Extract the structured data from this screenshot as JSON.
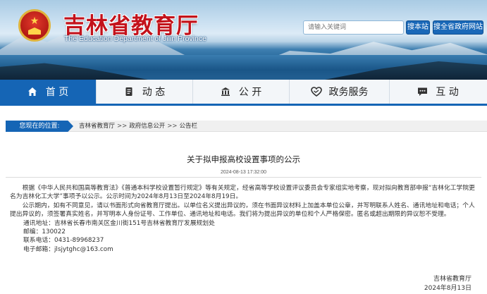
{
  "header": {
    "title": "吉林省教育厅",
    "subtitle": "The Education Department of Jilin Province",
    "search_placeholder": "请输入关键词",
    "search_site_label": "搜本站",
    "search_gov_label": "搜全省政府网站"
  },
  "nav": {
    "items": [
      {
        "label": "首 页",
        "icon": "home-icon"
      },
      {
        "label": "动 态",
        "icon": "document-icon"
      },
      {
        "label": "公 开",
        "icon": "government-building-icon"
      },
      {
        "label": "政务服务",
        "icon": "handshake-icon"
      },
      {
        "label": "互 动",
        "icon": "chat-icon"
      }
    ],
    "active_index": 0
  },
  "location": {
    "label": "您现在的位置:",
    "crumbs": [
      "吉林省教育厅",
      "政府信息公开",
      "公告栏"
    ],
    "separator": ">>"
  },
  "article": {
    "title": "关于拟申报高校设置事项的公示",
    "datetime": "2024-08-13 17:32:00",
    "para1": "根据《中华人民共和国高等教育法》《普通本科学校设置暂行规定》等有关规定，经省高等学校设置评议委员会专家组实地考察，现对拟向教育部申报“吉林化工学院更名为吉林化工大学”事项予以公示。公示时间为2024年8月13日至2024年8月19日。",
    "para2": "公示期内，如有不同意见，请以书面形式向省教育厅提出。以单位名义提出异议的，须在书面异议材料上加盖本单位公章，并写明联系人姓名、通讯地址和电话；个人提出异议的，须签署真实姓名，并写明本人身份证号、工作单位、通讯地址和电话。我们将为提出异议的单位和个人严格保密。匿名或超出期限的异议恕不受理。",
    "contact_address": "通讯地址：吉林省长春市南关区金川街151号吉林省教育厅发展规划处",
    "contact_postcode": "邮编：130022",
    "contact_phone": "联系电话：0431-89968237",
    "contact_email": "电子邮箱：jlsjytghc@163.com",
    "signature_org": "吉林省教育厅",
    "signature_date": "2024年8月13日"
  },
  "colors": {
    "brand_red": "#c3121b",
    "nav_blue": "#1565b5"
  }
}
